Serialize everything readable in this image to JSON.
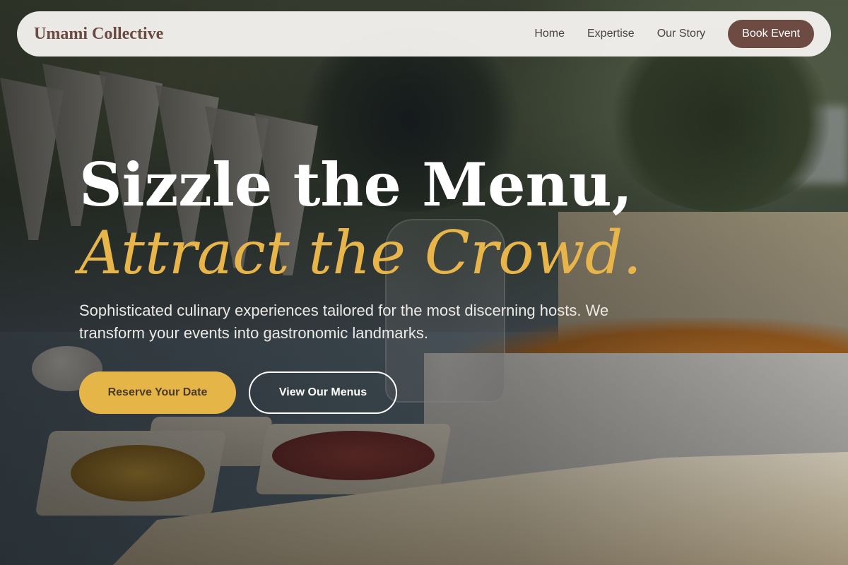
{
  "nav": {
    "brand": "Umami Collective",
    "links": [
      "Home",
      "Expertise",
      "Our Story"
    ],
    "cta": "Book Event"
  },
  "hero": {
    "headline_line1": "Sizzle the Menu,",
    "headline_line2": "Attract the Crowd.",
    "subtitle": "Sophisticated culinary experiences tailored for the most discerning hosts. We transform your events into gastronomic landmarks.",
    "primary_button": "Reserve Your Date",
    "secondary_button": "View Our Menus"
  },
  "colors": {
    "brand": "#6b4a42",
    "accent_gold": "#e6b548",
    "nav_cta_bg": "#6d4b43",
    "nav_bg": "#f5f3f0"
  }
}
